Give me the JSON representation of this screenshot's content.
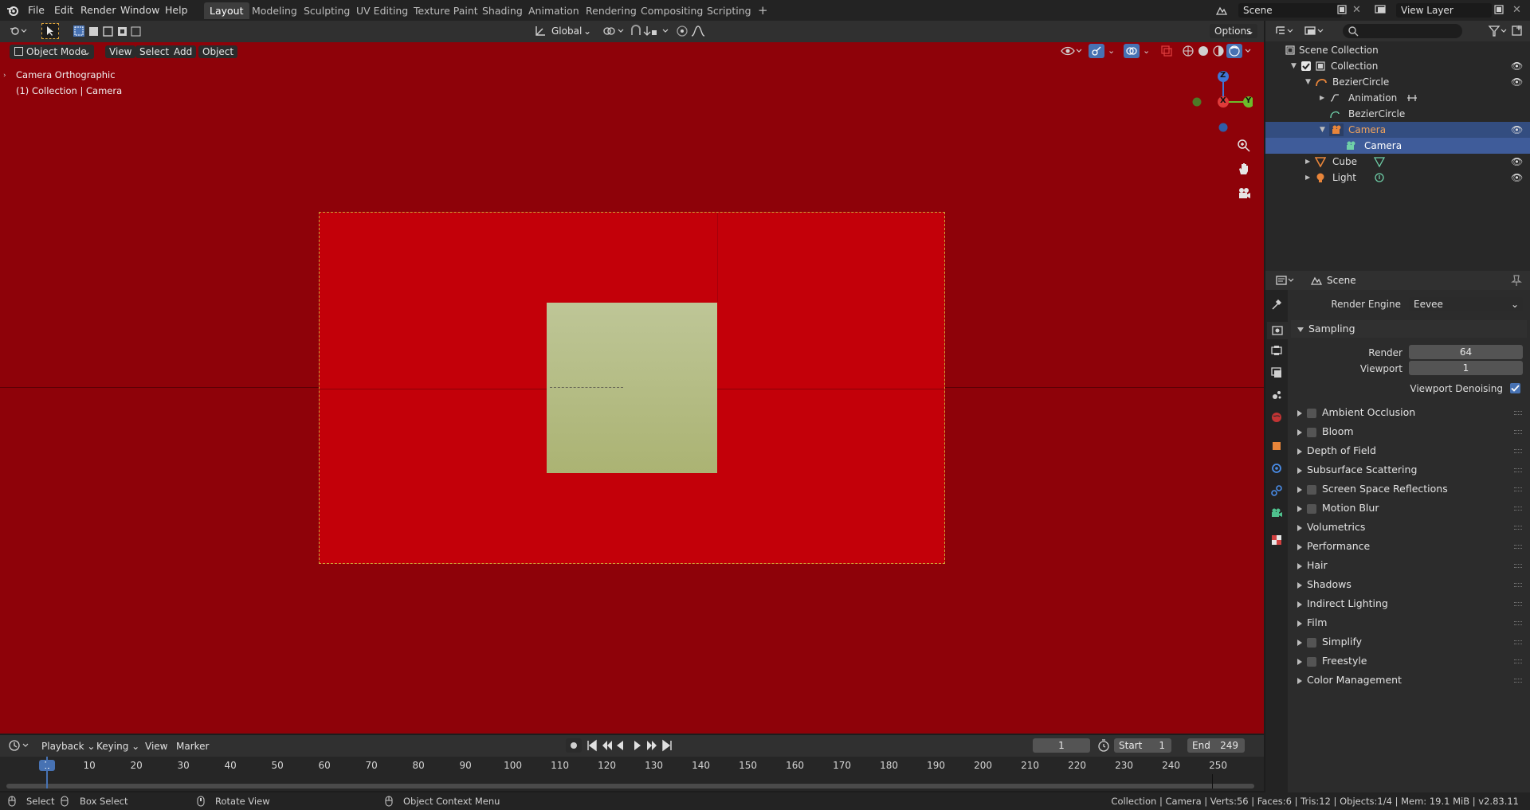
{
  "topbar": {
    "menus": [
      "File",
      "Edit",
      "Render",
      "Window",
      "Help"
    ],
    "workspaces": [
      "Layout",
      "Modeling",
      "Sculpting",
      "UV Editing",
      "Texture Paint",
      "Shading",
      "Animation",
      "Rendering",
      "Compositing",
      "Scripting"
    ],
    "active_workspace": "Layout",
    "add_workspace_label": "+",
    "scene_name": "Scene",
    "view_layer": "View Layer"
  },
  "header": {
    "mode": "Object Mode",
    "menus": [
      "View",
      "Select",
      "Add",
      "Object"
    ],
    "orientation": "Global",
    "options_label": "Options"
  },
  "viewport": {
    "view_name": "Camera Orthographic",
    "collection_info": "(1) Collection | Camera",
    "gizmo": {
      "z": "Z",
      "y": "Y",
      "x": "X"
    }
  },
  "outliner": {
    "search_placeholder": "",
    "rows": [
      {
        "label": "Scene Collection"
      },
      {
        "label": "Collection"
      },
      {
        "label": "BezierCircle"
      },
      {
        "label": "Animation"
      },
      {
        "label": "BezierCircle"
      },
      {
        "label": "Camera"
      },
      {
        "label": "Camera"
      },
      {
        "label": "Cube"
      },
      {
        "label": "Light"
      }
    ]
  },
  "properties": {
    "context": "Scene",
    "render_engine_label": "Render Engine",
    "render_engine_value": "Eevee",
    "sampling_label": "Sampling",
    "render_label": "Render",
    "render_value": "64",
    "viewport_label": "Viewport",
    "viewport_value": "1",
    "viewport_denoising_label": "Viewport Denoising",
    "viewport_denoising_checked": true,
    "panels": [
      {
        "label": "Ambient Occlusion",
        "checkbox": true
      },
      {
        "label": "Bloom",
        "checkbox": true
      },
      {
        "label": "Depth of Field",
        "checkbox": false
      },
      {
        "label": "Subsurface Scattering",
        "checkbox": false
      },
      {
        "label": "Screen Space Reflections",
        "checkbox": true
      },
      {
        "label": "Motion Blur",
        "checkbox": true
      },
      {
        "label": "Volumetrics",
        "checkbox": false
      },
      {
        "label": "Performance",
        "checkbox": false
      },
      {
        "label": "Hair",
        "checkbox": false
      },
      {
        "label": "Shadows",
        "checkbox": false
      },
      {
        "label": "Indirect Lighting",
        "checkbox": false
      },
      {
        "label": "Film",
        "checkbox": false
      },
      {
        "label": "Simplify",
        "checkbox": true
      },
      {
        "label": "Freestyle",
        "checkbox": true
      },
      {
        "label": "Color Management",
        "checkbox": false
      }
    ]
  },
  "timeline": {
    "menus": [
      "Playback",
      "Keying",
      "View",
      "Marker"
    ],
    "current_frame": "1",
    "start_label": "Start",
    "start_value": "1",
    "end_label": "End",
    "end_value": "249",
    "ruler_labels": [
      "1",
      "10",
      "20",
      "30",
      "40",
      "50",
      "60",
      "70",
      "80",
      "90",
      "100",
      "110",
      "120",
      "130",
      "140",
      "150",
      "160",
      "170",
      "180",
      "190",
      "200",
      "210",
      "220",
      "230",
      "240",
      "250"
    ]
  },
  "statusbar": {
    "select": "Select",
    "box_select": "Box Select",
    "rotate_view": "Rotate View",
    "context_menu": "Object Context Menu",
    "stats": "Collection | Camera | Verts:56 | Faces:6 | Tris:12 | Objects:1/4 | Mem: 19.1 MiB | v2.83.11"
  },
  "colors": {
    "viewport_bg": "#8e0209",
    "camera_frame": "#c30009",
    "cube": "#b3ba80",
    "selection": "#334d80",
    "accent": "#4772b3"
  }
}
